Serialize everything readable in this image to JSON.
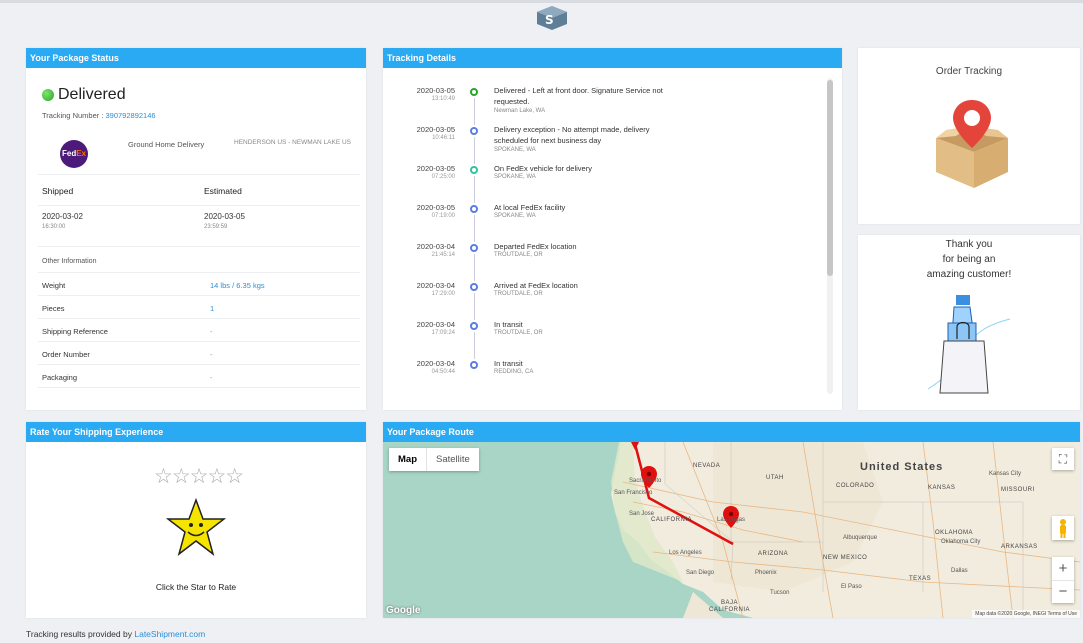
{
  "header": {
    "logo_text": "LS"
  },
  "status": {
    "panel_title": "Your Package Status",
    "state": "Delivered",
    "tracking_label": "Tracking Number :",
    "tracking_number": "390792892146",
    "carrier_logo_fed": "Fed",
    "carrier_logo_ex": "Ex",
    "service": "Ground Home Delivery",
    "route": "HENDERSON US - NEWMAN LAKE US",
    "shipped_label": "Shipped",
    "estimated_label": "Estimated",
    "shipped_date": "2020-03-02",
    "shipped_time": "16:30:00",
    "estimated_date": "2020-03-05",
    "estimated_time": "23:59:59",
    "other_info_label": "Other Information",
    "info": [
      {
        "label": "Weight",
        "value": "14 lbs / 6.35 kgs"
      },
      {
        "label": "Pieces",
        "value": "1"
      },
      {
        "label": "Shipping Reference",
        "value": "-"
      },
      {
        "label": "Order Number",
        "value": "-"
      },
      {
        "label": "Packaging",
        "value": "-"
      }
    ]
  },
  "tracking": {
    "panel_title": "Tracking Details",
    "events": [
      {
        "date": "2020-03-05",
        "time": "13:10:49",
        "desc": "Delivered - Left at front door. Signature Service not requested.",
        "loc": "Newman Lake, WA",
        "status": "delivered"
      },
      {
        "date": "2020-03-05",
        "time": "10:46:11",
        "desc": "Delivery exception - No attempt made, delivery scheduled for next business day",
        "loc": "SPOKANE, WA",
        "status": "normal"
      },
      {
        "date": "2020-03-05",
        "time": "07:25:00",
        "desc": "On FedEx vehicle for delivery",
        "loc": "SPOKANE, WA",
        "status": "out"
      },
      {
        "date": "2020-03-05",
        "time": "07:19:00",
        "desc": "At local FedEx facility",
        "loc": "SPOKANE, WA",
        "status": "normal"
      },
      {
        "date": "2020-03-04",
        "time": "21:45:14",
        "desc": "Departed FedEx location",
        "loc": "TROUTDALE, OR",
        "status": "normal"
      },
      {
        "date": "2020-03-04",
        "time": "17:29:00",
        "desc": "Arrived at FedEx location",
        "loc": "TROUTDALE, OR",
        "status": "normal"
      },
      {
        "date": "2020-03-04",
        "time": "17:09:24",
        "desc": "In transit",
        "loc": "TROUTDALE, OR",
        "status": "normal"
      },
      {
        "date": "2020-03-04",
        "time": "04:50:44",
        "desc": "In transit",
        "loc": "REDDING, CA",
        "status": "normal"
      }
    ]
  },
  "order": {
    "title": "Order Tracking"
  },
  "thanks": {
    "line1": "Thank you",
    "line2": "for being an",
    "line3": "amazing customer!"
  },
  "rate": {
    "panel_title": "Rate Your Shipping Experience",
    "stars": "☆☆☆☆☆",
    "cta": "Click the Star to Rate"
  },
  "route": {
    "panel_title": "Your Package Route",
    "map_tab": "Map",
    "satellite_tab": "Satellite",
    "labels": {
      "us": "United States",
      "nevada": "NEVADA",
      "utah": "UTAH",
      "colorado": "COLORADO",
      "kansas": "KANSAS",
      "missouri": "MISSOURI",
      "california": "CALIFORNIA",
      "arizona": "ARIZONA",
      "newmexico": "NEW MEXICO",
      "oklahoma": "OKLAHOMA",
      "texas": "TEXAS",
      "arkansas": "ARKANSAS",
      "sacramento": "Sacramento",
      "sf": "San Francisco",
      "sj": "San Jose",
      "lv": "Las Vegas",
      "la": "Los Angeles",
      "sd": "San Diego",
      "phoenix": "Phoenix",
      "tucson": "Tucson",
      "elpaso": "El Paso",
      "albuquerque": "Albuquerque",
      "dallas": "Dallas",
      "kc": "Kansas City",
      "oklahomacity": "Oklahoma City",
      "baja": "BAJA",
      "bajacal": "CALIFORNIA"
    },
    "google": "Google",
    "attribution": "Map data ©2020 Google, INEGI   Terms of Use"
  },
  "footer": {
    "prefix": "Tracking results provided by",
    "link": "LateShipment.com"
  },
  "colors": {
    "accent": "#2aaaf3",
    "link": "#2a8fd6",
    "delivered": "#2aa52a",
    "route": "#e01010"
  }
}
